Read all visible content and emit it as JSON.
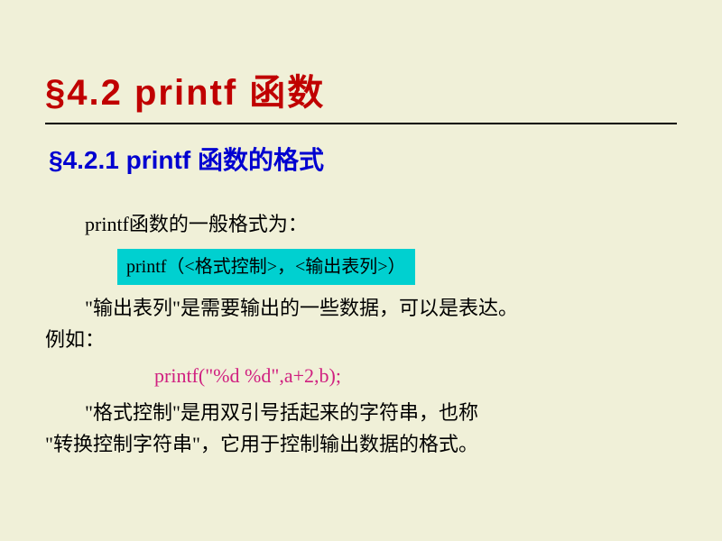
{
  "heading1": "§4.2   printf 函数",
  "heading2": "§4.2.1   printf 函数的格式",
  "para1": "printf函数的一般格式为：",
  "highlight": "printf（<格式控制>，<输出表列>）",
  "para2": "\"输出表列\"是需要输出的一些数据，可以是表达。",
  "para2b": "例如：",
  "code_example": "printf(\"%d %d\",a+2,b);",
  "para3": "\"格式控制\"是用双引号括起来的字符串，也称",
  "para3b": "\"转换控制字符串\"，它用于控制输出数据的格式。"
}
